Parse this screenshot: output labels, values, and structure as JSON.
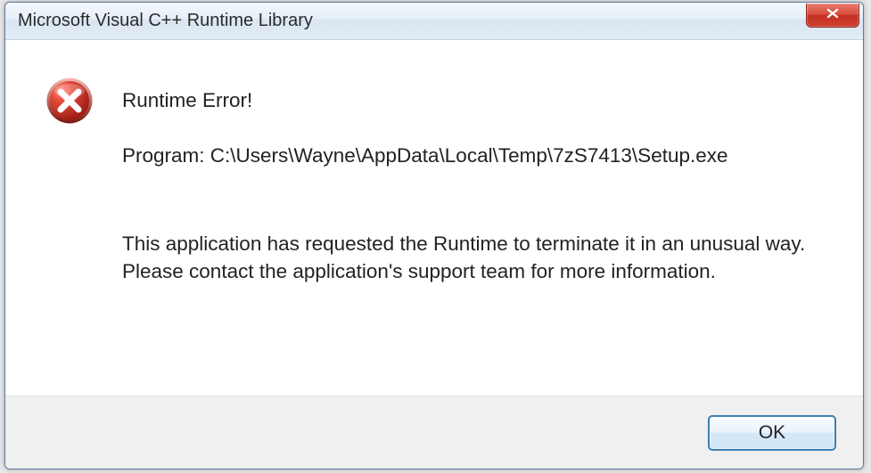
{
  "dialog": {
    "title": "Microsoft Visual C++ Runtime Library",
    "heading": "Runtime Error!",
    "program_label": "Program: ",
    "program_path": "C:\\Users\\Wayne\\AppData\\Local\\Temp\\7zS7413\\Setup.exe",
    "message_line1": "This application has requested the Runtime to terminate it in an unusual way.",
    "message_line2": "Please contact the application's support team for more information.",
    "ok_label": "OK"
  }
}
